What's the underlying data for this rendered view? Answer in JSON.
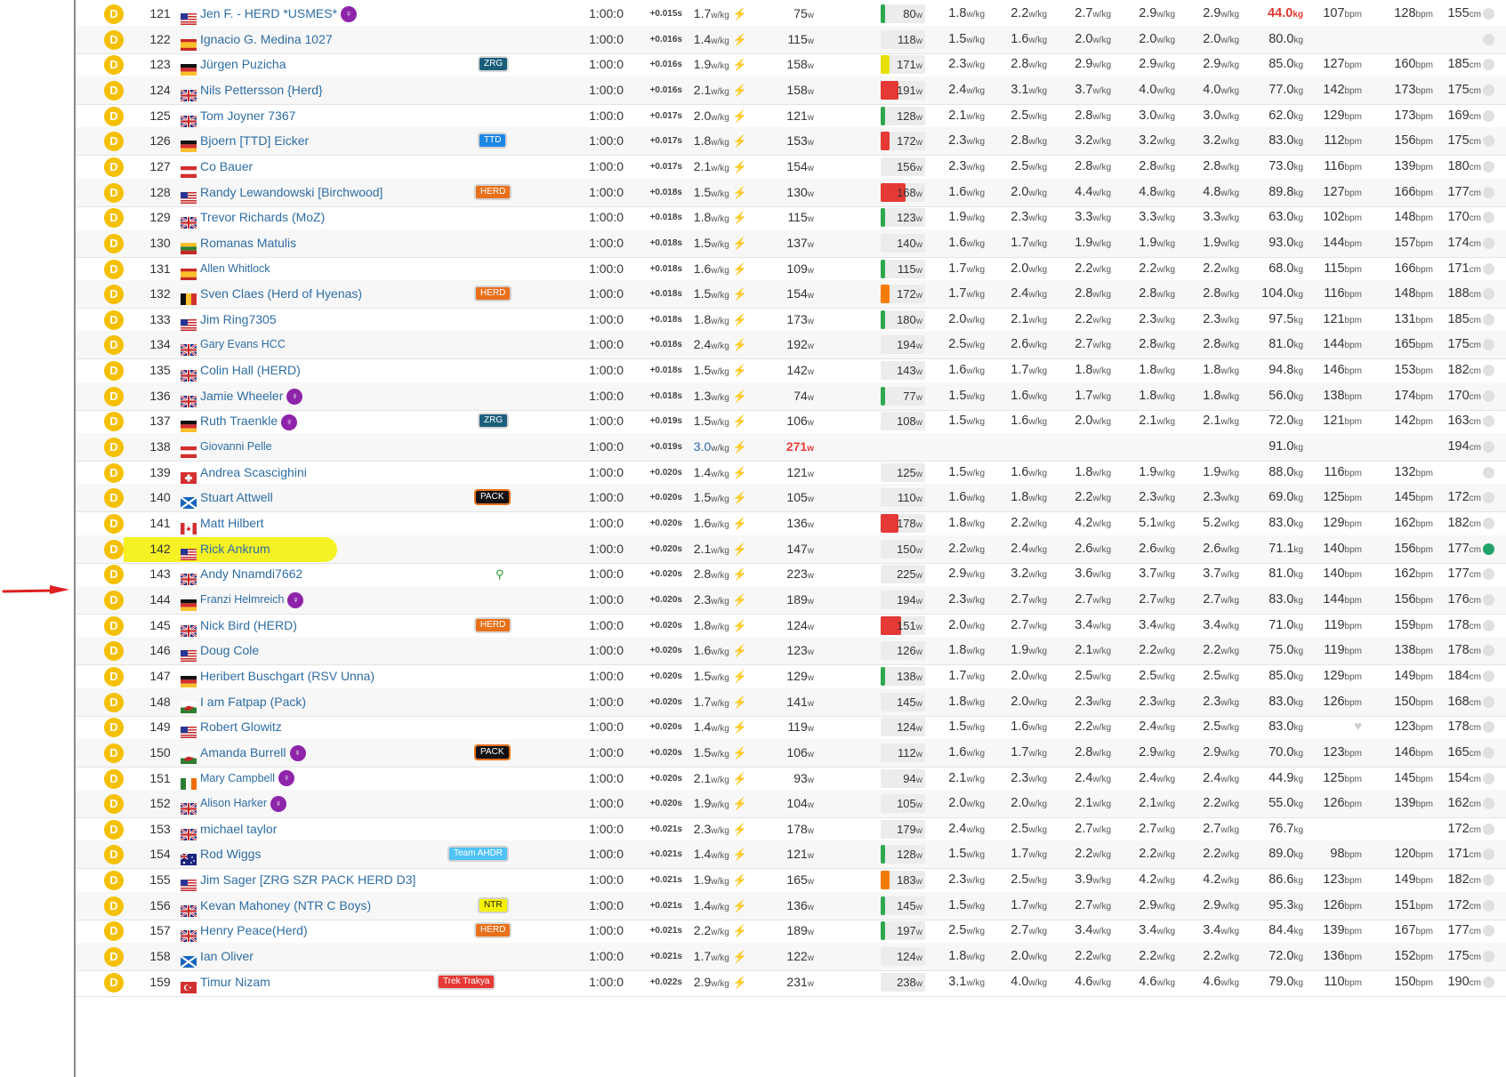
{
  "colors": {
    "category": "#f5c000",
    "link": "#2e6da4",
    "highlight": "#f5f000",
    "arrow": "#e02020",
    "bolt": "#2e9c2e",
    "red": "#e53935"
  },
  "units": {
    "wkg": "w/kg",
    "w": "w",
    "kg": "kg",
    "bpm": "bpm",
    "cm": "cm",
    "s": "s"
  },
  "rows": [
    {
      "cat": "D",
      "rank": "121",
      "flag": "us",
      "name": "Jen F. - HERD *USMES*",
      "female": true,
      "team": "",
      "time": "1:00:0",
      "gap": "+0.015s",
      "wkg": "1.7",
      "w": "75",
      "np": "80",
      "npcolor": "#2ea84f",
      "npfill": 10,
      "c": [
        "1.8",
        "2.2",
        "2.7",
        "2.9",
        "2.9"
      ],
      "weight": "44.0",
      "weightRed": true,
      "hr1": "107",
      "hr2": "128",
      "ht": "155"
    },
    {
      "cat": "D",
      "rank": "122",
      "flag": "es",
      "name": "Ignacio G. Medina 1027",
      "team": "",
      "time": "1:00:0",
      "gap": "+0.016s",
      "wkg": "1.4",
      "w": "115",
      "np": "118",
      "npcolor": "",
      "npfill": 0,
      "c": [
        "1.5",
        "1.6",
        "2.0",
        "2.0",
        "2.0"
      ],
      "weight": "80.0",
      "hr1": "",
      "hr2": "",
      "ht": ""
    },
    {
      "cat": "D",
      "rank": "123",
      "flag": "de",
      "name": "Jürgen Puzicha",
      "team": "ZRG",
      "teamColor": "#1b5e7b",
      "time": "1:00:0",
      "gap": "+0.016s",
      "wkg": "1.9",
      "w": "158",
      "np": "171",
      "npcolor": "#e8e000",
      "npfill": 20,
      "c": [
        "2.3",
        "2.8",
        "2.9",
        "2.9",
        "2.9"
      ],
      "weight": "85.0",
      "hr1": "127",
      "hr2": "160",
      "ht": "185"
    },
    {
      "cat": "D",
      "rank": "124",
      "flag": "gb",
      "name": "Nils Pettersson {Herd}",
      "team": "",
      "time": "1:00:0",
      "gap": "+0.016s",
      "wkg": "2.1",
      "w": "158",
      "np": "191",
      "npcolor": "#e53935",
      "npfill": 40,
      "c": [
        "2.4",
        "3.1",
        "3.7",
        "4.0",
        "4.0"
      ],
      "weight": "77.0",
      "hr1": "142",
      "hr2": "173",
      "ht": "175"
    },
    {
      "cat": "D",
      "rank": "125",
      "flag": "gb",
      "name": "Tom Joyner 7367",
      "team": "",
      "time": "1:00:0",
      "gap": "+0.017s",
      "wkg": "2.0",
      "w": "121",
      "np": "128",
      "npcolor": "#2ea84f",
      "npfill": 10,
      "c": [
        "2.1",
        "2.5",
        "2.8",
        "3.0",
        "3.0"
      ],
      "weight": "62.0",
      "hr1": "129",
      "hr2": "173",
      "ht": "169"
    },
    {
      "cat": "D",
      "rank": "126",
      "flag": "de",
      "name": "Bjoern [TTD] Eicker",
      "team": "TTD",
      "teamColor": "#1e88e5",
      "time": "1:00:0",
      "gap": "+0.017s",
      "wkg": "1.8",
      "w": "153",
      "np": "172",
      "npcolor": "#e53935",
      "npfill": 20,
      "c": [
        "2.3",
        "2.8",
        "3.2",
        "3.2",
        "3.2"
      ],
      "weight": "83.0",
      "hr1": "112",
      "hr2": "156",
      "ht": "175"
    },
    {
      "cat": "D",
      "rank": "127",
      "flag": "at",
      "name": "Co Bauer",
      "team": "",
      "time": "1:00:0",
      "gap": "+0.017s",
      "wkg": "2.1",
      "w": "154",
      "np": "156",
      "npcolor": "",
      "npfill": 0,
      "c": [
        "2.3",
        "2.5",
        "2.8",
        "2.8",
        "2.8"
      ],
      "weight": "73.0",
      "hr1": "116",
      "hr2": "139",
      "ht": "180"
    },
    {
      "cat": "D",
      "rank": "128",
      "flag": "us",
      "name": "Randy Lewandowski [Birchwood]",
      "team": "HERD",
      "teamColor": "#e8701a",
      "time": "1:00:0",
      "gap": "+0.018s",
      "wkg": "1.5",
      "w": "130",
      "np": "168",
      "npcolor": "#e53935",
      "npfill": 55,
      "c": [
        "1.6",
        "2.0",
        "4.4",
        "4.8",
        "4.8"
      ],
      "weight": "89.8",
      "hr1": "127",
      "hr2": "166",
      "ht": "177"
    },
    {
      "cat": "D",
      "rank": "129",
      "flag": "gb",
      "name": "Trevor Richards (MoZ)",
      "team": "",
      "time": "1:00:0",
      "gap": "+0.018s",
      "wkg": "1.8",
      "w": "115",
      "np": "123",
      "npcolor": "#2ea84f",
      "npfill": 10,
      "c": [
        "1.9",
        "2.3",
        "3.3",
        "3.3",
        "3.3"
      ],
      "weight": "63.0",
      "hr1": "102",
      "hr2": "148",
      "ht": "170"
    },
    {
      "cat": "D",
      "rank": "130",
      "flag": "lt",
      "name": "Romanas Matulis",
      "team": "",
      "time": "1:00:0",
      "gap": "+0.018s",
      "wkg": "1.5",
      "w": "137",
      "np": "140",
      "npcolor": "",
      "npfill": 0,
      "c": [
        "1.6",
        "1.7",
        "1.9",
        "1.9",
        "1.9"
      ],
      "weight": "93.0",
      "hr1": "144",
      "hr2": "157",
      "ht": "174"
    },
    {
      "cat": "D",
      "rank": "131",
      "flag": "es",
      "name": "Allen Whitlock",
      "small": true,
      "team": "",
      "time": "1:00:0",
      "gap": "+0.018s",
      "wkg": "1.6",
      "w": "109",
      "np": "115",
      "npcolor": "#2ea84f",
      "npfill": 10,
      "c": [
        "1.7",
        "2.0",
        "2.2",
        "2.2",
        "2.2"
      ],
      "weight": "68.0",
      "hr1": "115",
      "hr2": "166",
      "ht": "171"
    },
    {
      "cat": "D",
      "rank": "132",
      "flag": "be",
      "name": "Sven Claes (Herd of Hyenas)",
      "team": "HERD",
      "teamColor": "#e8701a",
      "time": "1:00:0",
      "gap": "+0.018s",
      "wkg": "1.5",
      "w": "154",
      "np": "172",
      "npcolor": "#f57c00",
      "npfill": 20,
      "c": [
        "1.7",
        "2.4",
        "2.8",
        "2.8",
        "2.8"
      ],
      "weight": "104.0",
      "hr1": "116",
      "hr2": "148",
      "ht": "188"
    },
    {
      "cat": "D",
      "rank": "133",
      "flag": "us",
      "name": "Jim Ring7305",
      "team": "",
      "time": "1:00:0",
      "gap": "+0.018s",
      "wkg": "1.8",
      "w": "173",
      "np": "180",
      "npcolor": "#2ea84f",
      "npfill": 10,
      "c": [
        "2.0",
        "2.1",
        "2.2",
        "2.3",
        "2.3"
      ],
      "weight": "97.5",
      "hr1": "121",
      "hr2": "131",
      "ht": "185"
    },
    {
      "cat": "D",
      "rank": "134",
      "flag": "gb",
      "name": "Gary Evans HCC",
      "small": true,
      "team": "",
      "time": "1:00:0",
      "gap": "+0.018s",
      "wkg": "2.4",
      "w": "192",
      "np": "194",
      "npcolor": "",
      "npfill": 0,
      "c": [
        "2.5",
        "2.6",
        "2.7",
        "2.8",
        "2.8"
      ],
      "weight": "81.0",
      "hr1": "144",
      "hr2": "165",
      "ht": "175"
    },
    {
      "cat": "D",
      "rank": "135",
      "flag": "gb",
      "name": "Colin Hall (HERD)",
      "team": "",
      "time": "1:00:0",
      "gap": "+0.018s",
      "wkg": "1.5",
      "w": "142",
      "np": "143",
      "npcolor": "",
      "npfill": 0,
      "c": [
        "1.6",
        "1.7",
        "1.8",
        "1.8",
        "1.8"
      ],
      "weight": "94.8",
      "hr1": "146",
      "hr2": "153",
      "ht": "182"
    },
    {
      "cat": "D",
      "rank": "136",
      "flag": "gb",
      "name": "Jamie Wheeler",
      "female": true,
      "team": "",
      "time": "1:00:0",
      "gap": "+0.018s",
      "wkg": "1.3",
      "w": "74",
      "np": "77",
      "npcolor": "#2ea84f",
      "npfill": 10,
      "c": [
        "1.5",
        "1.6",
        "1.7",
        "1.8",
        "1.8"
      ],
      "weight": "56.0",
      "hr1": "138",
      "hr2": "174",
      "ht": "170"
    },
    {
      "cat": "D",
      "rank": "137",
      "flag": "de",
      "name": "Ruth Traenkle",
      "female": true,
      "team": "ZRG",
      "teamColor": "#1b5e7b",
      "time": "1:00:0",
      "gap": "+0.019s",
      "wkg": "1.5",
      "w": "106",
      "np": "108",
      "npcolor": "",
      "npfill": 0,
      "c": [
        "1.5",
        "1.6",
        "2.0",
        "2.1",
        "2.1"
      ],
      "weight": "72.0",
      "hr1": "121",
      "hr2": "142",
      "ht": "163"
    },
    {
      "cat": "D",
      "rank": "138",
      "flag": "at",
      "name": "Giovanni Pelle",
      "small": true,
      "team": "",
      "time": "1:00:0",
      "gap": "+0.019s",
      "wkg": "3.0",
      "wkgBlue": true,
      "w": "271",
      "wRed": true,
      "np": "",
      "npcolor": "",
      "npfill": 0,
      "c": [
        "",
        "",
        "",
        "",
        ""
      ],
      "weight": "91.0",
      "hr1": "",
      "hr2": "",
      "ht": "194"
    },
    {
      "cat": "D",
      "rank": "139",
      "flag": "ch",
      "name": "Andrea Scascighini",
      "team": "",
      "time": "1:00:0",
      "gap": "+0.020s",
      "wkg": "1.4",
      "w": "121",
      "np": "125",
      "npcolor": "",
      "npfill": 0,
      "c": [
        "1.5",
        "1.6",
        "1.8",
        "1.9",
        "1.9"
      ],
      "weight": "88.0",
      "hr1": "116",
      "hr2": "132",
      "ht": ""
    },
    {
      "cat": "D",
      "rank": "140",
      "flag": "sc",
      "name": "Stuart Attwell",
      "team": "PACK",
      "teamColor": "#111111",
      "time": "1:00:0",
      "gap": "+0.020s",
      "wkg": "1.5",
      "w": "105",
      "np": "110",
      "npcolor": "",
      "npfill": 0,
      "c": [
        "1.6",
        "1.8",
        "2.2",
        "2.3",
        "2.3"
      ],
      "weight": "69.0",
      "hr1": "125",
      "hr2": "145",
      "ht": "172"
    },
    {
      "cat": "D",
      "rank": "141",
      "flag": "ca",
      "name": "Matt Hilbert",
      "team": "",
      "time": "1:00:0",
      "gap": "+0.020s",
      "wkg": "1.6",
      "w": "136",
      "np": "178",
      "npcolor": "#e53935",
      "npfill": 40,
      "c": [
        "1.8",
        "2.2",
        "4.2",
        "5.1",
        "5.2"
      ],
      "weight": "83.0",
      "hr1": "129",
      "hr2": "162",
      "ht": "182"
    },
    {
      "cat": "D",
      "rank": "142",
      "flag": "us",
      "name": "Rick Ankrum",
      "team": "",
      "highlight": true,
      "time": "1:00:0",
      "gap": "+0.020s",
      "wkg": "2.1",
      "w": "147",
      "np": "150",
      "npcolor": "",
      "npfill": 0,
      "c": [
        "2.2",
        "2.4",
        "2.6",
        "2.6",
        "2.6"
      ],
      "weight": "71.1",
      "hr1": "140",
      "hr2": "156",
      "ht": "177",
      "activeClock": true
    },
    {
      "cat": "D",
      "rank": "143",
      "flag": "gb",
      "name": "Andy Nnamdi7662",
      "team": "",
      "search": true,
      "time": "1:00:0",
      "gap": "+0.020s",
      "wkg": "2.8",
      "w": "223",
      "np": "225",
      "npcolor": "",
      "npfill": 0,
      "c": [
        "2.9",
        "3.2",
        "3.6",
        "3.7",
        "3.7"
      ],
      "weight": "81.0",
      "hr1": "140",
      "hr2": "162",
      "ht": "177"
    },
    {
      "cat": "D",
      "rank": "144",
      "flag": "de",
      "name": "Franzi Helmreich",
      "female": true,
      "small": true,
      "team": "",
      "time": "1:00:0",
      "gap": "+0.020s",
      "wkg": "2.3",
      "w": "189",
      "np": "194",
      "npcolor": "",
      "npfill": 0,
      "c": [
        "2.3",
        "2.7",
        "2.7",
        "2.7",
        "2.7"
      ],
      "weight": "83.0",
      "hr1": "144",
      "hr2": "156",
      "ht": "176"
    },
    {
      "cat": "D",
      "rank": "145",
      "flag": "gb",
      "name": "Nick Bird (HERD)",
      "team": "HERD",
      "teamColor": "#e8701a",
      "time": "1:00:0",
      "gap": "+0.020s",
      "wkg": "1.8",
      "w": "124",
      "np": "151",
      "npcolor": "#e53935",
      "npfill": 45,
      "c": [
        "2.0",
        "2.7",
        "3.4",
        "3.4",
        "3.4"
      ],
      "weight": "71.0",
      "hr1": "119",
      "hr2": "159",
      "ht": "178"
    },
    {
      "cat": "D",
      "rank": "146",
      "flag": "us",
      "name": "Doug Cole",
      "team": "",
      "time": "1:00:0",
      "gap": "+0.020s",
      "wkg": "1.6",
      "w": "123",
      "np": "126",
      "npcolor": "",
      "npfill": 0,
      "c": [
        "1.8",
        "1.9",
        "2.1",
        "2.2",
        "2.2"
      ],
      "weight": "75.0",
      "hr1": "119",
      "hr2": "138",
      "ht": "178"
    },
    {
      "cat": "D",
      "rank": "147",
      "flag": "de",
      "name": "Heribert Buschgart (RSV Unna)",
      "team": "",
      "time": "1:00:0",
      "gap": "+0.020s",
      "wkg": "1.5",
      "w": "129",
      "np": "138",
      "npcolor": "#2ea84f",
      "npfill": 10,
      "c": [
        "1.7",
        "2.0",
        "2.5",
        "2.5",
        "2.5"
      ],
      "weight": "85.0",
      "hr1": "129",
      "hr2": "149",
      "ht": "184"
    },
    {
      "cat": "D",
      "rank": "148",
      "flag": "wa",
      "name": "I am Fatpap (Pack)",
      "team": "",
      "time": "1:00:0",
      "gap": "+0.020s",
      "wkg": "1.7",
      "w": "141",
      "np": "145",
      "npcolor": "",
      "npfill": 0,
      "c": [
        "1.8",
        "2.0",
        "2.3",
        "2.3",
        "2.3"
      ],
      "weight": "83.0",
      "hr1": "126",
      "hr2": "150",
      "ht": "168"
    },
    {
      "cat": "D",
      "rank": "149",
      "flag": "us",
      "name": "Robert Glowitz",
      "team": "",
      "time": "1:00:0",
      "gap": "+0.020s",
      "wkg": "1.4",
      "w": "119",
      "np": "124",
      "npcolor": "",
      "npfill": 0,
      "c": [
        "1.5",
        "1.6",
        "2.2",
        "2.4",
        "2.5"
      ],
      "weight": "83.0",
      "hr1": "",
      "heart": true,
      "hr2": "123",
      "ht": "178"
    },
    {
      "cat": "D",
      "rank": "150",
      "flag": "wa",
      "name": "Amanda Burrell",
      "female": true,
      "team": "PACK",
      "teamColor": "#111111",
      "time": "1:00:0",
      "gap": "+0.020s",
      "wkg": "1.5",
      "w": "106",
      "np": "112",
      "npcolor": "",
      "npfill": 0,
      "c": [
        "1.6",
        "1.7",
        "2.8",
        "2.9",
        "2.9"
      ],
      "weight": "70.0",
      "hr1": "123",
      "hr2": "146",
      "ht": "165"
    },
    {
      "cat": "D",
      "rank": "151",
      "flag": "ie",
      "name": "Mary Campbell",
      "female": true,
      "small": true,
      "team": "",
      "time": "1:00:0",
      "gap": "+0.020s",
      "wkg": "2.1",
      "w": "93",
      "np": "94",
      "npcolor": "",
      "npfill": 0,
      "c": [
        "2.1",
        "2.3",
        "2.4",
        "2.4",
        "2.4"
      ],
      "weight": "44.9",
      "hr1": "125",
      "hr2": "145",
      "ht": "154"
    },
    {
      "cat": "D",
      "rank": "152",
      "flag": "gb",
      "name": "Alison Harker",
      "female": true,
      "small": true,
      "team": "",
      "time": "1:00:0",
      "gap": "+0.020s",
      "wkg": "1.9",
      "w": "104",
      "np": "105",
      "npcolor": "",
      "npfill": 0,
      "c": [
        "2.0",
        "2.0",
        "2.1",
        "2.1",
        "2.2"
      ],
      "weight": "55.0",
      "hr1": "126",
      "hr2": "139",
      "ht": "162"
    },
    {
      "cat": "D",
      "rank": "153",
      "flag": "gb",
      "name": "michael taylor",
      "team": "",
      "time": "1:00:0",
      "gap": "+0.021s",
      "wkg": "2.3",
      "w": "178",
      "np": "179",
      "npcolor": "",
      "npfill": 0,
      "c": [
        "2.4",
        "2.5",
        "2.7",
        "2.7",
        "2.7"
      ],
      "weight": "76.7",
      "hr1": "",
      "hr2": "",
      "ht": "172"
    },
    {
      "cat": "D",
      "rank": "154",
      "flag": "au",
      "name": "Rod Wiggs",
      "team": "Team AHDR",
      "teamColor": "#4fc3f7",
      "time": "1:00:0",
      "gap": "+0.021s",
      "wkg": "1.4",
      "w": "121",
      "np": "128",
      "npcolor": "#2ea84f",
      "npfill": 10,
      "c": [
        "1.5",
        "1.7",
        "2.2",
        "2.2",
        "2.2"
      ],
      "weight": "89.0",
      "hr1": "98",
      "hr2": "120",
      "ht": "171"
    },
    {
      "cat": "D",
      "rank": "155",
      "flag": "us",
      "name": "Jim Sager [ZRG SZR PACK HERD D3]",
      "team": "",
      "time": "1:00:0",
      "gap": "+0.021s",
      "wkg": "1.9",
      "w": "165",
      "np": "183",
      "npcolor": "#f57c00",
      "npfill": 20,
      "c": [
        "2.3",
        "2.5",
        "3.9",
        "4.2",
        "4.2"
      ],
      "weight": "86.6",
      "hr1": "123",
      "hr2": "149",
      "ht": "182"
    },
    {
      "cat": "D",
      "rank": "156",
      "flag": "gb",
      "name": "Kevan Mahoney (NTR C Boys)",
      "team": "NTR",
      "teamColor": "#f5f000",
      "teamText": "#222",
      "time": "1:00:0",
      "gap": "+0.021s",
      "wkg": "1.4",
      "w": "136",
      "np": "145",
      "npcolor": "#2ea84f",
      "npfill": 10,
      "c": [
        "1.5",
        "1.7",
        "2.7",
        "2.9",
        "2.9"
      ],
      "weight": "95.3",
      "hr1": "126",
      "hr2": "151",
      "ht": "172"
    },
    {
      "cat": "D",
      "rank": "157",
      "flag": "gb",
      "name": "Henry Peace(Herd)",
      "team": "HERD",
      "teamColor": "#e8701a",
      "time": "1:00:0",
      "gap": "+0.021s",
      "wkg": "2.2",
      "w": "189",
      "np": "197",
      "npcolor": "#2ea84f",
      "npfill": 10,
      "c": [
        "2.5",
        "2.7",
        "3.4",
        "3.4",
        "3.4"
      ],
      "weight": "84.4",
      "hr1": "139",
      "hr2": "167",
      "ht": "177"
    },
    {
      "cat": "D",
      "rank": "158",
      "flag": "sc",
      "name": "Ian Oliver",
      "team": "",
      "time": "1:00:0",
      "gap": "+0.021s",
      "wkg": "1.7",
      "w": "122",
      "np": "124",
      "npcolor": "",
      "npfill": 0,
      "c": [
        "1.8",
        "2.0",
        "2.2",
        "2.2",
        "2.2"
      ],
      "weight": "72.0",
      "hr1": "136",
      "hr2": "152",
      "ht": "175"
    },
    {
      "cat": "D",
      "rank": "159",
      "flag": "tr",
      "name": "Timur Nizam",
      "team": "Trek Trakya",
      "teamColor": "#e53935",
      "time": "1:00:0",
      "gap": "+0.022s",
      "wkg": "2.9",
      "w": "231",
      "np": "238",
      "npcolor": "",
      "npfill": 0,
      "c": [
        "3.1",
        "4.0",
        "4.6",
        "4.6",
        "4.6"
      ],
      "weight": "79.0",
      "hr1": "110",
      "hr2": "150",
      "ht": "190"
    }
  ]
}
